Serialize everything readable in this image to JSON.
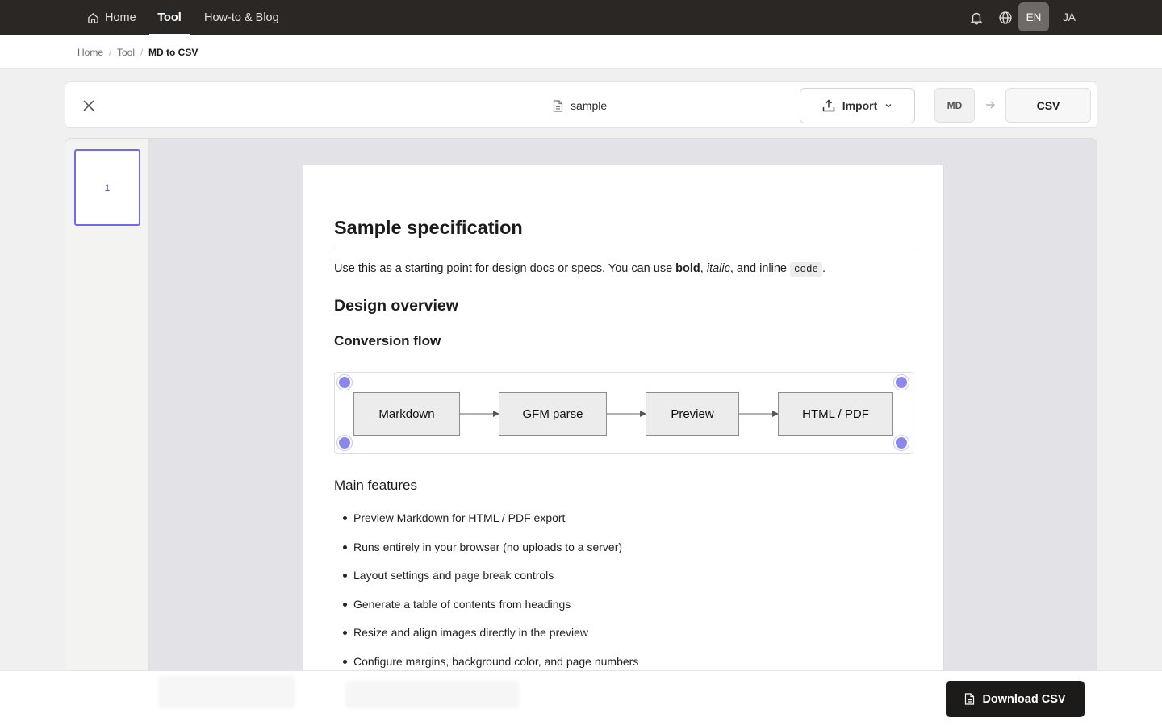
{
  "nav": {
    "home": "Home",
    "tool": "Tool",
    "blog": "How-to & Blog",
    "lang_en": "EN",
    "lang_ja": "JA",
    "icons": [
      "home-icon",
      "bell-icon",
      "globe-icon"
    ]
  },
  "breadcrumb": {
    "home": "Home",
    "tool": "Tool",
    "current": "MD to CSV",
    "separator": "/"
  },
  "toolbar": {
    "filename": "sample",
    "import_label": "Import",
    "from_format": "MD",
    "to_format": "CSV",
    "icons": [
      "close-icon",
      "file-icon",
      "upload-icon",
      "chevron-down-icon",
      "arrow-right-icon"
    ]
  },
  "thumbnails": [
    {
      "page": "1"
    }
  ],
  "document": {
    "title": "Sample specification",
    "intro_start": "Use this as a starting point for design docs or specs. You can use ",
    "bold": "bold",
    "comma": ", ",
    "italic": "italic",
    "and_inline": ", and inline ",
    "code": "code",
    "period": ".",
    "h2": "Design overview",
    "h3_flow": "Conversion flow",
    "flow_nodes": [
      "Markdown",
      "GFM parse",
      "Preview",
      "HTML / PDF"
    ],
    "h3_features": "Main features",
    "features": [
      "Preview Markdown for HTML / PDF export",
      "Runs entirely in your browser (no uploads to a server)",
      "Layout settings and page break controls",
      "Generate a table of contents from headings",
      "Resize and align images directly in the preview",
      "Configure margins, background color, and page numbers"
    ]
  },
  "footer": {
    "download_label": "Download CSV"
  },
  "colors": {
    "nav_bg": "#2a2725",
    "accent": "#6d6cf0",
    "handle": "#8b88ec",
    "primary_button": "#1d1b1a"
  }
}
